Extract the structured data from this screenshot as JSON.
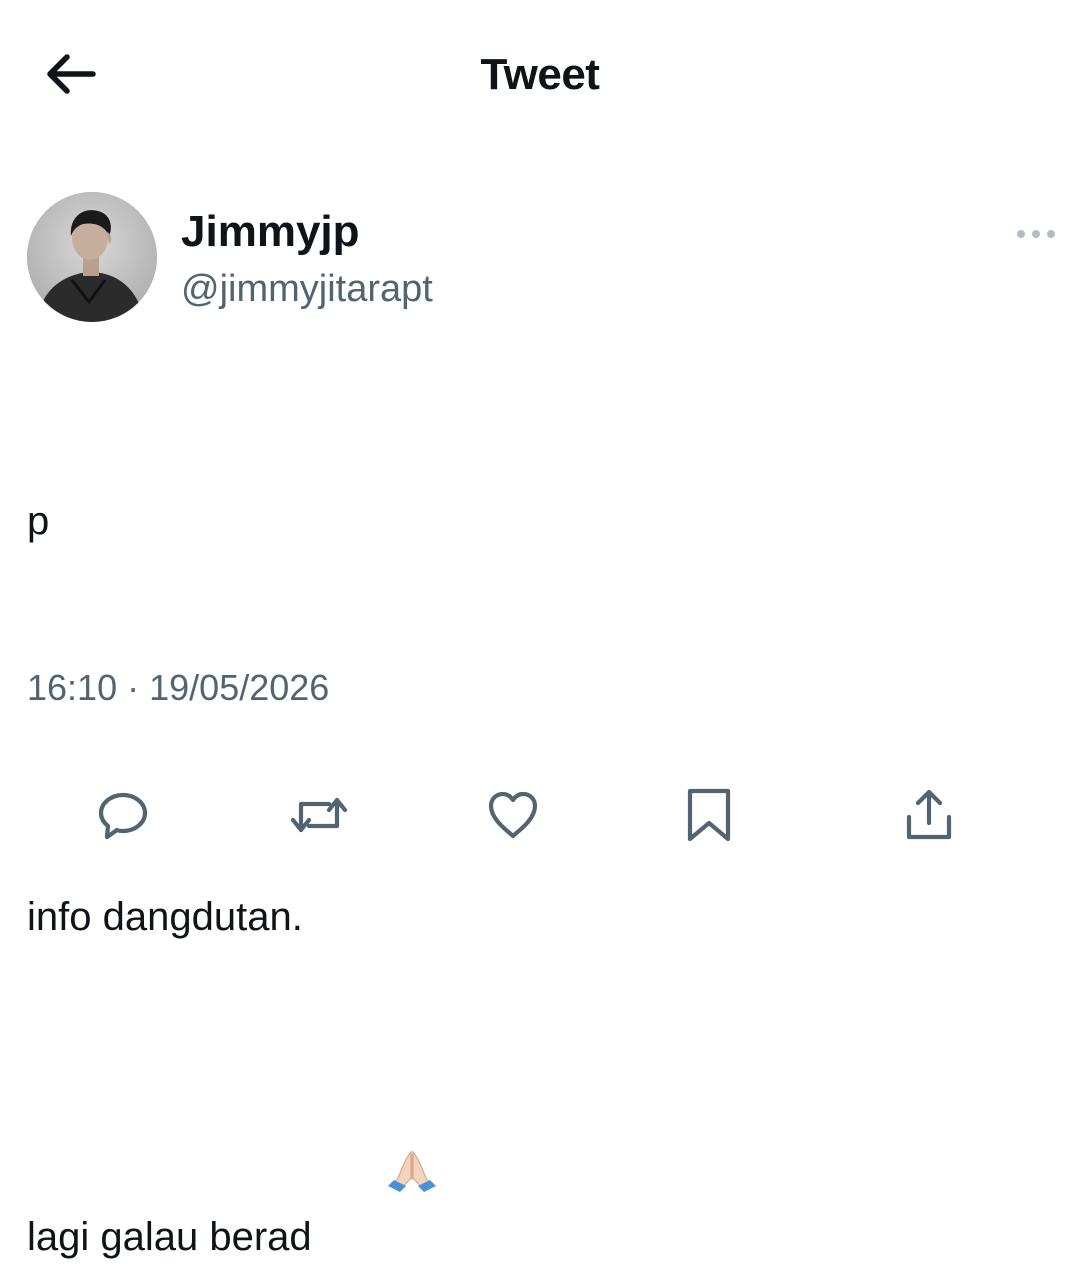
{
  "header": {
    "title": "Tweet",
    "back_icon": "arrow-left-icon"
  },
  "author": {
    "display_name": "Jimmyjp",
    "handle": "@jimmyjitarapt",
    "more_icon": "more-horizontal-icon"
  },
  "tweet": {
    "lines": [
      "p",
      "",
      "info dangdutan.",
      "lagi galau berad"
    ],
    "emoji": "folded-hands-emoji",
    "time": "16:10",
    "separator": "·",
    "date": "19/05/2026"
  },
  "actions": [
    {
      "icon": "reply-icon"
    },
    {
      "icon": "retweet-icon"
    },
    {
      "icon": "like-icon"
    },
    {
      "icon": "bookmark-icon"
    },
    {
      "icon": "share-icon"
    }
  ],
  "colors": {
    "text_primary": "#0f1419",
    "text_secondary": "#536471",
    "background": "#ffffff"
  }
}
